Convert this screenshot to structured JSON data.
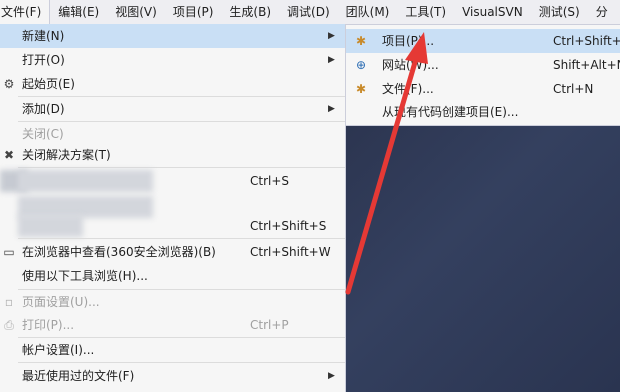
{
  "menubar": {
    "items": [
      "文件(F)",
      "编辑(E)",
      "视图(V)",
      "项目(P)",
      "生成(B)",
      "调试(D)",
      "团队(M)",
      "工具(T)",
      "VisualSVN",
      "测试(S)",
      "分"
    ]
  },
  "file_menu": {
    "items": {
      "new": {
        "label": "新建(N)"
      },
      "open": {
        "label": "打开(O)"
      },
      "start_page": {
        "label": "起始页(E)"
      },
      "add": {
        "label": "添加(D)"
      },
      "close": {
        "label": "关闭(C)"
      },
      "close_solution": {
        "label": "关闭解决方案(T)"
      },
      "save": {
        "shortcut": "Ctrl+S"
      },
      "save_all": {
        "shortcut": "Ctrl+Shift+S"
      },
      "view_in_browser": {
        "label": "在浏览器中查看(360安全浏览器)(B)",
        "shortcut": "Ctrl+Shift+W"
      },
      "browse_with": {
        "label": "使用以下工具浏览(H)..."
      },
      "page_setup": {
        "label": "页面设置(U)..."
      },
      "print": {
        "label": "打印(P)...",
        "shortcut": "Ctrl+P"
      },
      "account_settings": {
        "label": "帐户设置(I)..."
      },
      "recent_files": {
        "label": "最近使用过的文件(F)"
      }
    }
  },
  "new_submenu": {
    "items": {
      "project": {
        "label": "项目(P)...",
        "shortcut": "Ctrl+Shift+N"
      },
      "website": {
        "label": "网站(W)...",
        "shortcut": "Shift+Alt+N"
      },
      "file": {
        "label": "文件(F)...",
        "shortcut": "Ctrl+N"
      },
      "from_existing": {
        "label": "从现有代码创建项目(E)..."
      }
    }
  },
  "colors": {
    "highlight": "#c9dff5",
    "menu_bg": "#f6f6f6",
    "annotation_arrow": "#e53935",
    "ide_background": "#2d3a5a"
  },
  "icons": {
    "project": "new-project-icon",
    "website": "globe-icon",
    "file": "new-file-icon",
    "start_page": "gear-icon",
    "close_solution": "close-solution-icon",
    "view_in_browser": "browser-icon",
    "print": "printer-icon"
  }
}
